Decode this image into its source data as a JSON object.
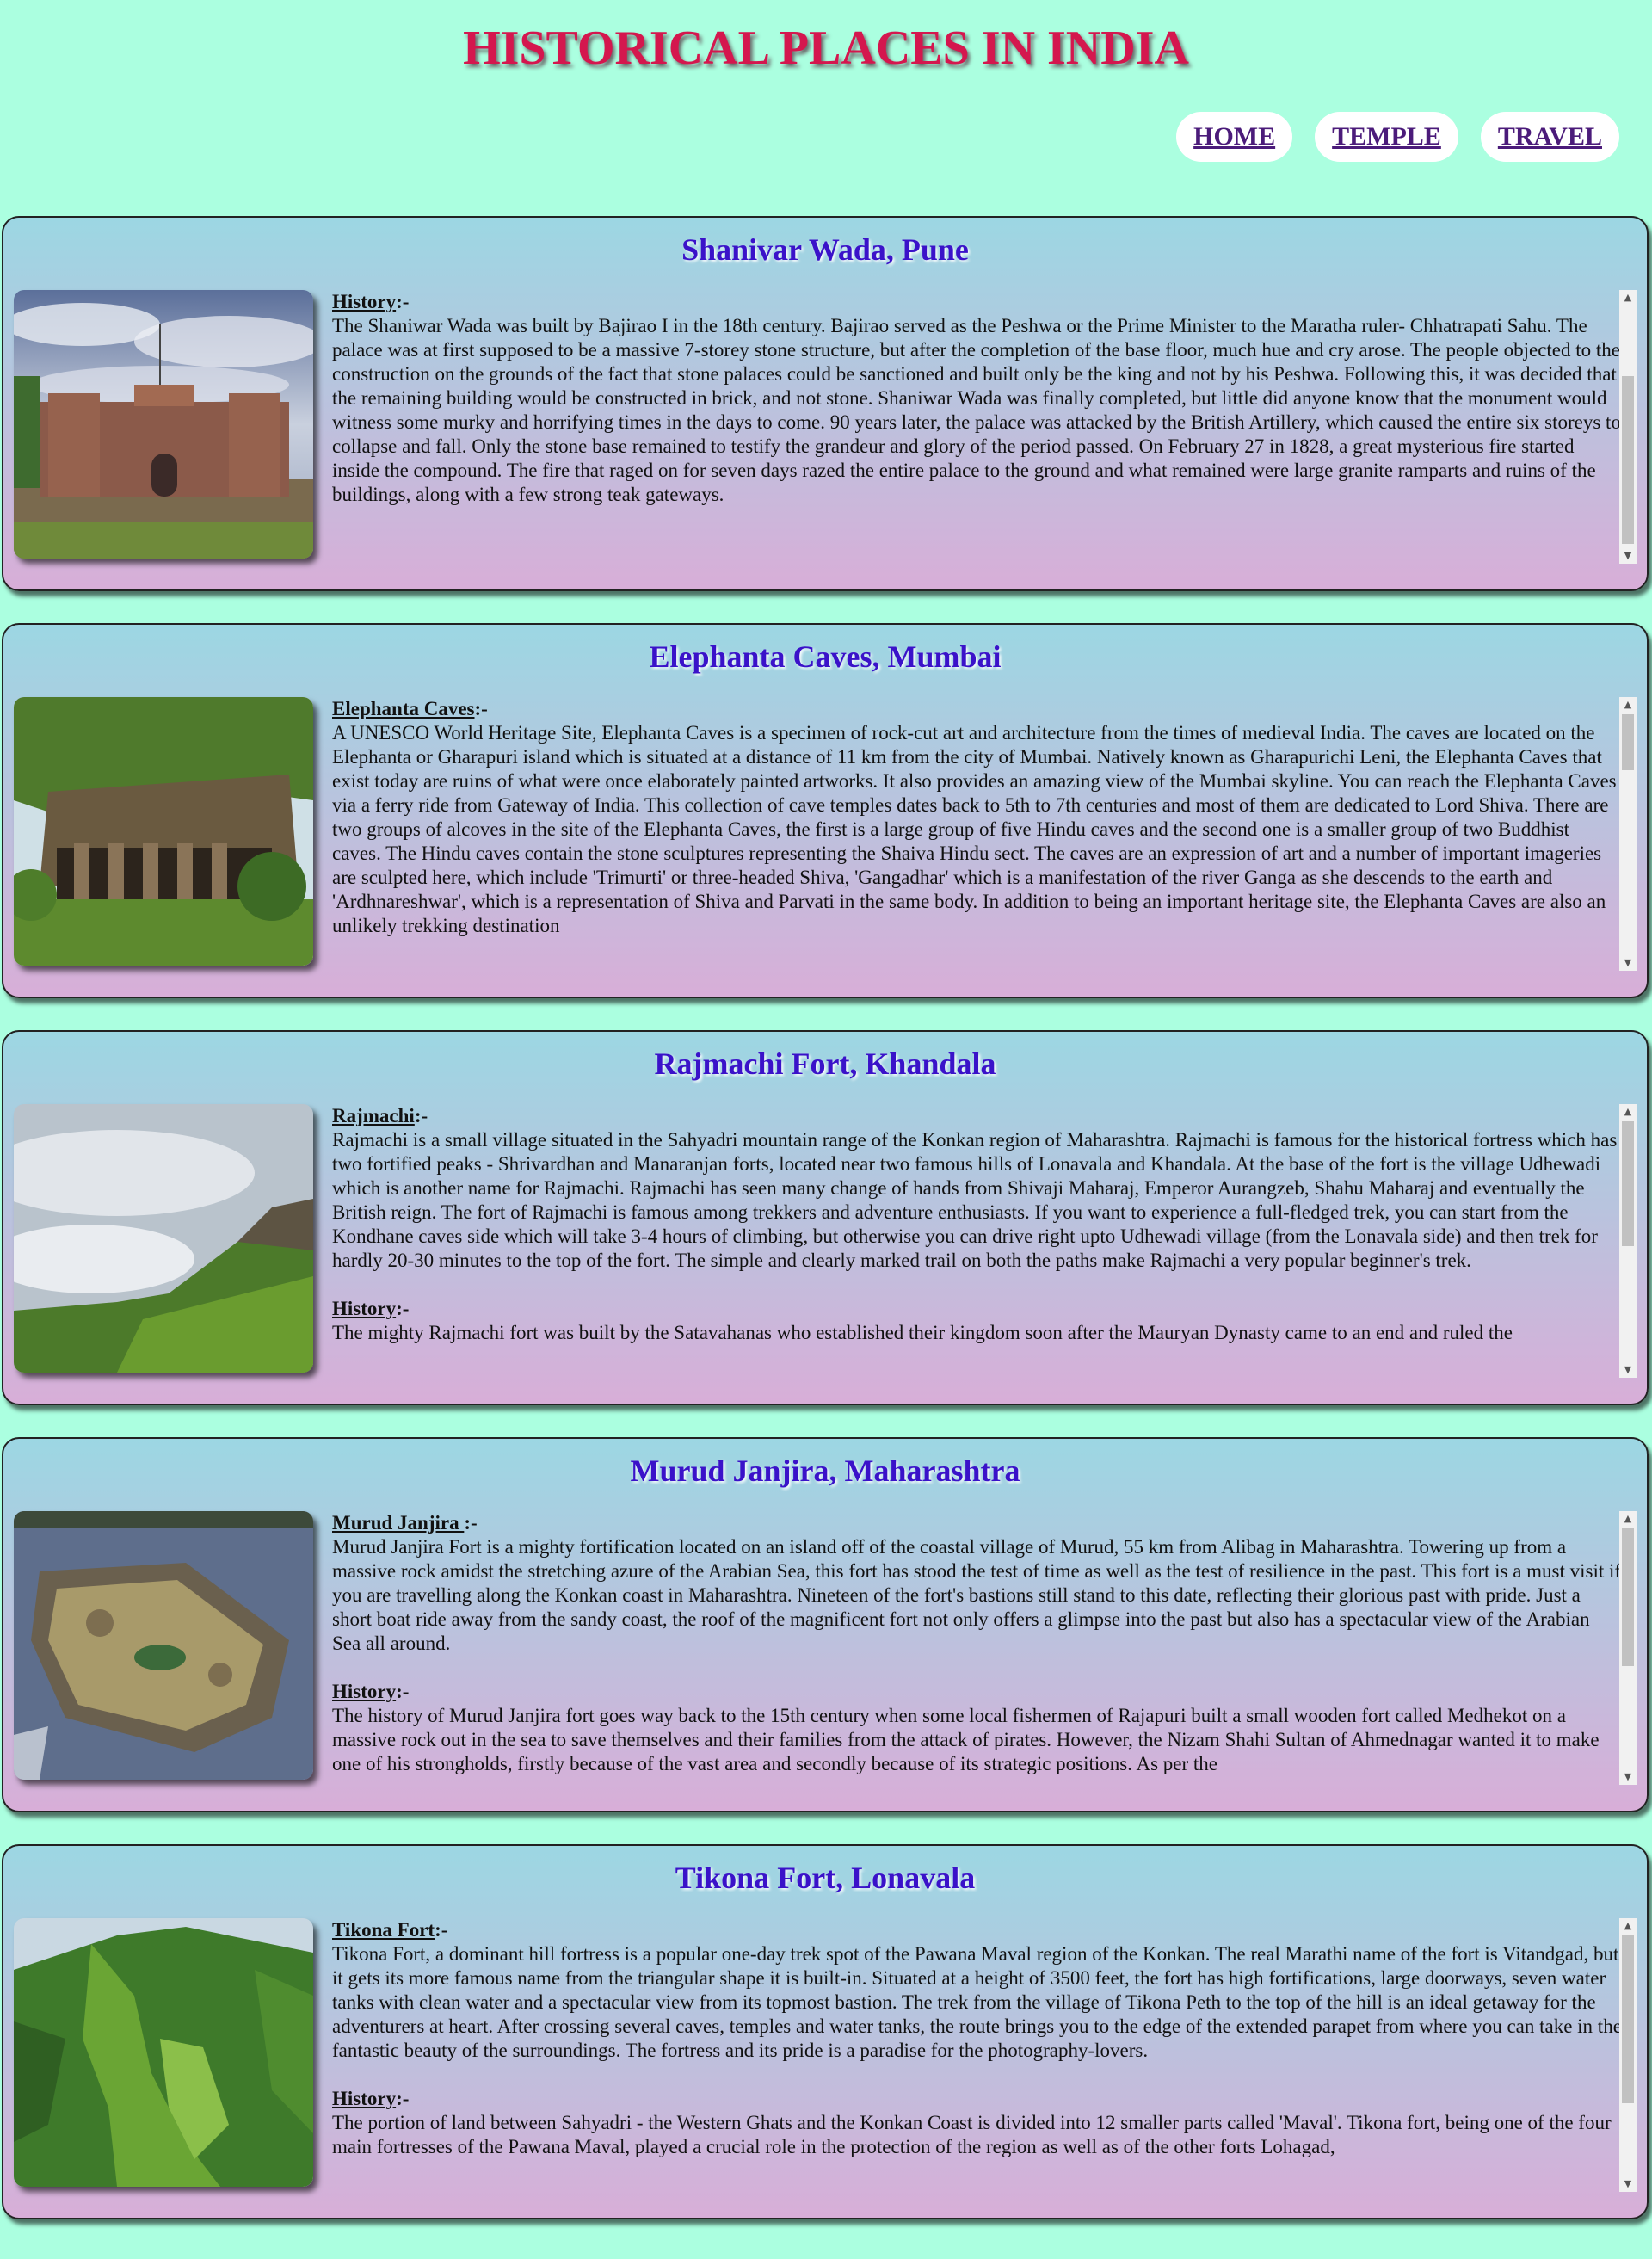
{
  "site": {
    "title": "HISTORICAL PLACES IN INDIA"
  },
  "nav": {
    "items": [
      {
        "label": "HOME"
      },
      {
        "label": "TEMPLE"
      },
      {
        "label": "TRAVEL"
      }
    ]
  },
  "places": [
    {
      "title": "Shanivar Wada, Pune",
      "sections": [
        {
          "heading": "History",
          "suffix": ":-",
          "text": "The Shaniwar Wada was built by Bajirao I in the 18th century. Bajirao served as the Peshwa or the Prime Minister to the Maratha ruler- Chhatrapati Sahu. The palace was at first supposed to be a massive 7-storey stone structure, but after the completion of the base floor, much hue and cry arose. The people objected to the construction on the grounds of the fact that stone palaces could be sanctioned and built only be the king and not by his Peshwa. Following this, it was decided that the remaining building would be constructed in brick, and not stone. Shaniwar Wada was finally completed, but little did anyone know that the monument would witness some murky and horrifying times in the days to come. 90 years later, the palace was attacked by the British Artillery, which caused the entire six storeys to collapse and fall. Only the stone base remained to testify the grandeur and glory of the period passed. On February 27 in 1828, a great mysterious fire started inside the compound. The fire that raged on for seven days razed the entire palace to the ground and what remained were large granite ramparts and ruins of the buildings, along with a few strong teak gateways."
        }
      ]
    },
    {
      "title": "Elephanta Caves, Mumbai",
      "sections": [
        {
          "heading": "Elephanta Caves",
          "suffix": ":-",
          "text": "A UNESCO World Heritage Site, Elephanta Caves is a specimen of rock-cut art and architecture from the times of medieval India. The caves are located on the Elephanta or Gharapuri island which is situated at a distance of 11 km from the city of Mumbai. Natively known as Gharapurichi Leni, the Elephanta Caves that exist today are ruins of what were once elaborately painted artworks. It also provides an amazing view of the Mumbai skyline. You can reach the Elephanta Caves via a ferry ride from Gateway of India. This collection of cave temples dates back to 5th to 7th centuries and most of them are dedicated to Lord Shiva. There are two groups of alcoves in the site of the Elephanta Caves, the first is a large group of five Hindu caves and the second one is a smaller group of two Buddhist caves. The Hindu caves contain the stone sculptures representing the Shaiva Hindu sect. The caves are an expression of art and a number of important imageries are sculpted here, which include 'Trimurti' or three-headed Shiva, 'Gangadhar' which is a manifestation of the river Ganga as she descends to the earth and 'Ardhnareshwar', which is a representation of Shiva and Parvati in the same body. In addition to being an important heritage site, the Elephanta Caves are also an unlikely trekking destination"
        }
      ]
    },
    {
      "title": "Rajmachi Fort, Khandala",
      "sections": [
        {
          "heading": "Rajmachi",
          "suffix": ":-",
          "text": "Rajmachi is a small village situated in the Sahyadri mountain range of the Konkan region of Maharashtra. Rajmachi is famous for the historical fortress which has two fortified peaks - Shrivardhan and Manaranjan forts, located near two famous hills of Lonavala and Khandala. At the base of the fort is the village Udhewadi which is another name for Rajmachi. Rajmachi has seen many change of hands from Shivaji Maharaj, Emperor Aurangzeb, Shahu Maharaj and eventually the British reign. The fort of Rajmachi is famous among trekkers and adventure enthusiasts. If you want to experience a full-fledged trek, you can start from the Kondhane caves side which will take 3-4 hours of climbing, but otherwise you can drive right upto Udhewadi village (from the Lonavala side) and then trek for hardly 20-30 minutes to the top of the fort. The simple and clearly marked trail on both the paths make Rajmachi a very popular beginner's trek."
        },
        {
          "heading": "History",
          "suffix": ":-",
          "text": "The mighty Rajmachi fort was built by the Satavahanas who established their kingdom soon after the Mauryan Dynasty came to an end and ruled the"
        }
      ]
    },
    {
      "title": "Murud Janjira, Maharashtra",
      "sections": [
        {
          "heading": "Murud Janjira ",
          "suffix": ":-",
          "text": "Murud Janjira Fort is a mighty fortification located on an island off of the coastal village of Murud, 55 km from Alibag in Maharashtra. Towering up from a massive rock amidst the stretching azure of the Arabian Sea, this fort has stood the test of time as well as the test of resilience in the past. This fort is a must visit if you are travelling along the Konkan coast in Maharashtra. Nineteen of the fort's bastions still stand to this date, reflecting their glorious past with pride. Just a short boat ride away from the sandy coast, the roof of the magnificent fort not only offers a glimpse into the past but also has a spectacular view of the Arabian Sea all around."
        },
        {
          "heading": "History",
          "suffix": ":-",
          "text": "The history of Murud Janjira fort goes way back to the 15th century when some local fishermen of Rajapuri built a small wooden fort called Medhekot on a massive rock out in the sea to save themselves and their families from the attack of pirates. However, the Nizam Shahi Sultan of Ahmednagar wanted it to make one of his strongholds, firstly because of the vast area and secondly because of its strategic positions. As per the"
        }
      ]
    },
    {
      "title": "Tikona Fort, Lonavala",
      "sections": [
        {
          "heading": "Tikona Fort",
          "suffix": ":-",
          "text": "Tikona Fort, a dominant hill fortress is a popular one-day trek spot of the Pawana Maval region of the Konkan. The real Marathi name of the fort is Vitandgad, but it gets its more famous name from the triangular shape it is built-in. Situated at a height of 3500 feet, the fort has high fortifications, large doorways, seven water tanks with clean water and a spectacular view from its topmost bastion. The trek from the village of Tikona Peth to the top of the hill is an ideal getaway for the adventurers at heart. After crossing several caves, temples and water tanks, the route brings you to the edge of the extended parapet from where you can take in the fantastic beauty of the surroundings. The fortress and its pride is a paradise for the photography-lovers."
        },
        {
          "heading": "History",
          "suffix": ":-",
          "text": "The portion of land between Sahyadri - the Western Ghats and the Konkan Coast is divided into 12 smaller parts called 'Maval'. Tikona fort, being one of the four main fortresses of the Pawana Maval, played a crucial role in the protection of the region as well as of the other forts Lohagad,"
        }
      ]
    }
  ],
  "colors": {
    "background": "#abffe0",
    "title": "#d4174e",
    "card_title": "#3a12c9",
    "nav_link": "#4b1b7a"
  }
}
